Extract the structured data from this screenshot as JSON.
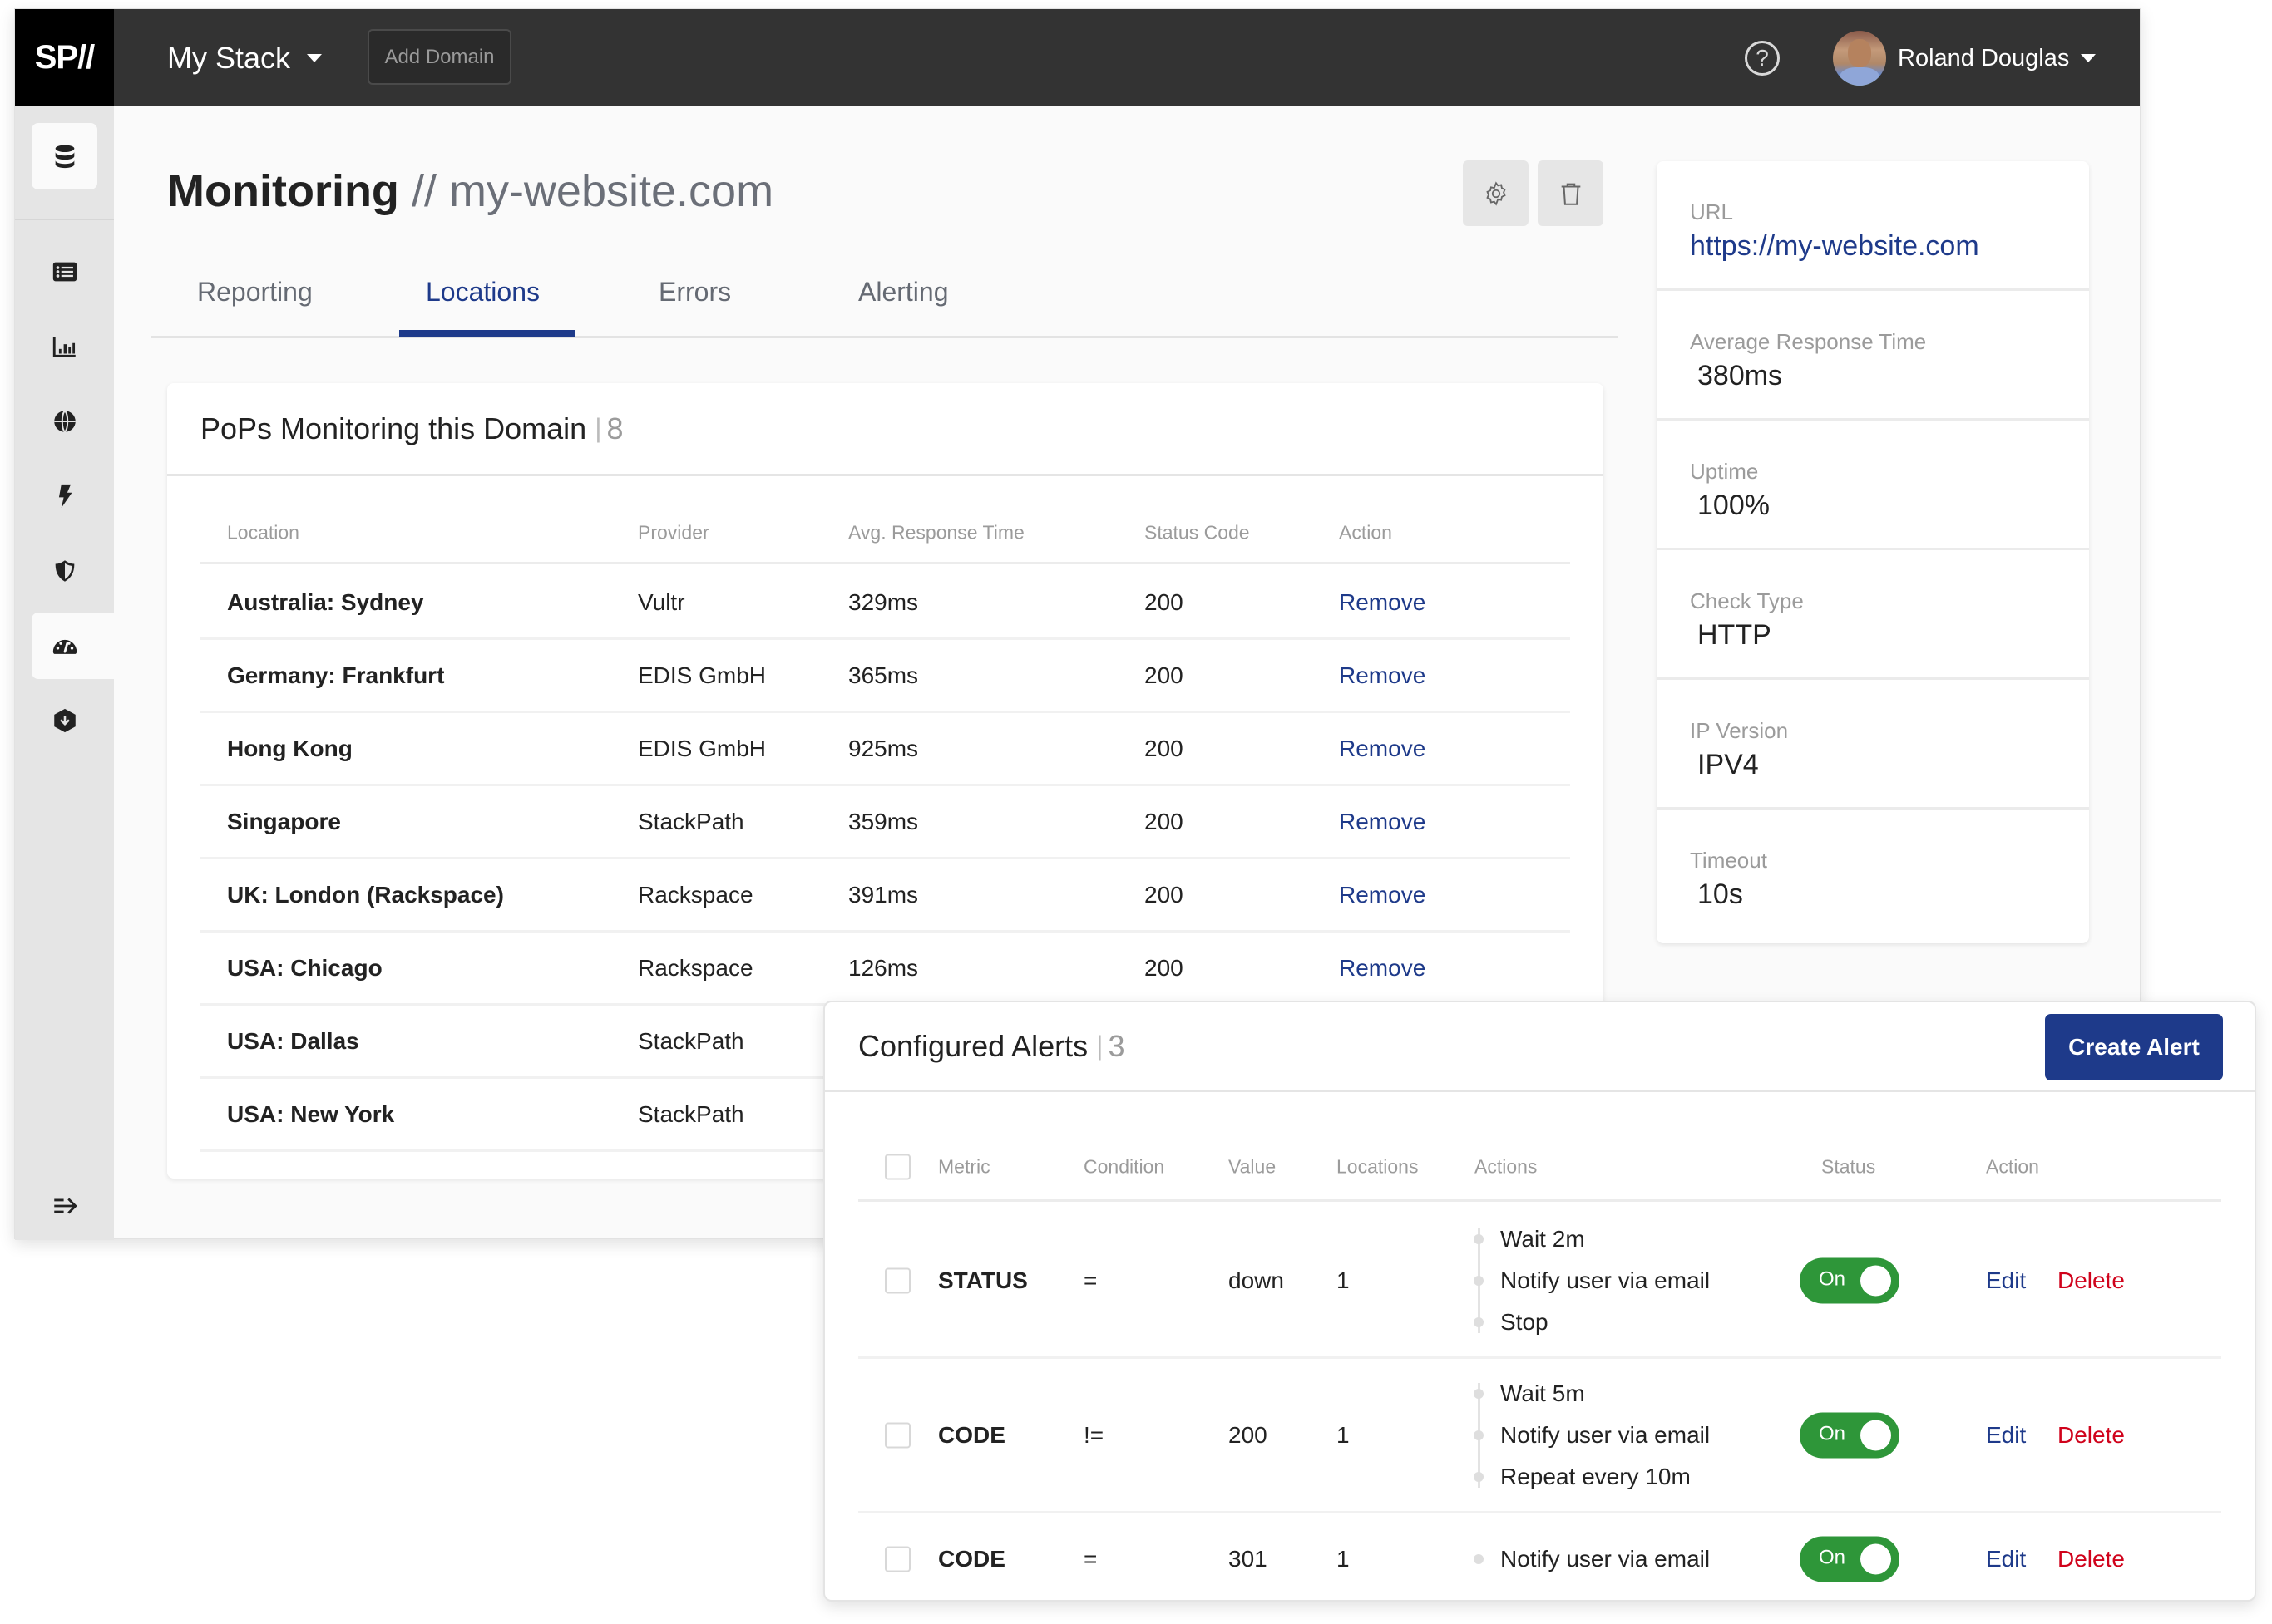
{
  "header": {
    "logo": "SP//",
    "stack_name": "My Stack",
    "add_domain_label": "Add Domain",
    "help_glyph": "?",
    "user_name": "Roland Douglas"
  },
  "sidebar": {
    "items": [
      {
        "icon": "database-icon",
        "active": true
      },
      {
        "icon": "list-icon"
      },
      {
        "icon": "bar-chart-icon"
      },
      {
        "icon": "globe-icon"
      },
      {
        "icon": "lightning-icon"
      },
      {
        "icon": "shield-icon"
      },
      {
        "icon": "speedometer-icon",
        "active": true
      },
      {
        "icon": "download-hexagon-icon"
      }
    ],
    "collapse_icon": "collapse-arrow-icon"
  },
  "page": {
    "title": "Monitoring",
    "separator": "//",
    "domain": "my-website.com",
    "tabs": [
      {
        "label": "Reporting"
      },
      {
        "label": "Locations",
        "active": true
      },
      {
        "label": "Errors"
      },
      {
        "label": "Alerting"
      }
    ]
  },
  "pops": {
    "title": "PoPs Monitoring this Domain",
    "count": "8",
    "columns": [
      "Location",
      "Provider",
      "Avg. Response Time",
      "Status Code",
      "Action"
    ],
    "rows": [
      {
        "location": "Australia: Sydney",
        "provider": "Vultr",
        "avg": "329ms",
        "status": "200",
        "action": "Remove"
      },
      {
        "location": "Germany: Frankfurt",
        "provider": "EDIS GmbH",
        "avg": "365ms",
        "status": "200",
        "action": "Remove"
      },
      {
        "location": "Hong Kong",
        "provider": "EDIS GmbH",
        "avg": "925ms",
        "status": "200",
        "action": "Remove"
      },
      {
        "location": "Singapore",
        "provider": "StackPath",
        "avg": "359ms",
        "status": "200",
        "action": "Remove"
      },
      {
        "location": "UK: London (Rackspace)",
        "provider": "Rackspace",
        "avg": "391ms",
        "status": "200",
        "action": "Remove"
      },
      {
        "location": "USA: Chicago",
        "provider": "Rackspace",
        "avg": "126ms",
        "status": "200",
        "action": "Remove"
      },
      {
        "location": "USA: Dallas",
        "provider": "StackPath",
        "avg": "",
        "status": "",
        "action": ""
      },
      {
        "location": "USA: New York",
        "provider": "StackPath",
        "avg": "",
        "status": "",
        "action": ""
      }
    ]
  },
  "info": {
    "items": [
      {
        "label": "URL",
        "value": "https://my-website.com"
      },
      {
        "label": "Average Response Time",
        "value": "380ms"
      },
      {
        "label": "Uptime",
        "value": "100%"
      },
      {
        "label": "Check Type",
        "value": "HTTP"
      },
      {
        "label": "IP Version",
        "value": "IPV4"
      },
      {
        "label": "Timeout",
        "value": "10s"
      }
    ]
  },
  "alerts": {
    "title": "Configured Alerts",
    "count": "3",
    "create_label": "Create Alert",
    "columns": [
      "Metric",
      "Condition",
      "Value",
      "Locations",
      "Actions",
      "Status",
      "Action"
    ],
    "rows": [
      {
        "metric": "STATUS",
        "condition": "=",
        "value": "down",
        "locations": "1",
        "actions": [
          "Wait 2m",
          "Notify user via email",
          "Stop"
        ],
        "status": "On",
        "edit": "Edit",
        "delete": "Delete"
      },
      {
        "metric": "CODE",
        "condition": "!=",
        "value": "200",
        "locations": "1",
        "actions": [
          "Wait 5m",
          "Notify user via email",
          "Repeat every 10m"
        ],
        "status": "On",
        "edit": "Edit",
        "delete": "Delete"
      },
      {
        "metric": "CODE",
        "condition": "=",
        "value": "301",
        "locations": "1",
        "actions": [
          "Notify user via email"
        ],
        "status": "On",
        "edit": "Edit",
        "delete": "Delete"
      }
    ]
  },
  "colors": {
    "brand_blue": "#1e3a8a",
    "danger_red": "#d0021b",
    "toggle_green": "#2e9639",
    "header_bg": "#333333"
  }
}
